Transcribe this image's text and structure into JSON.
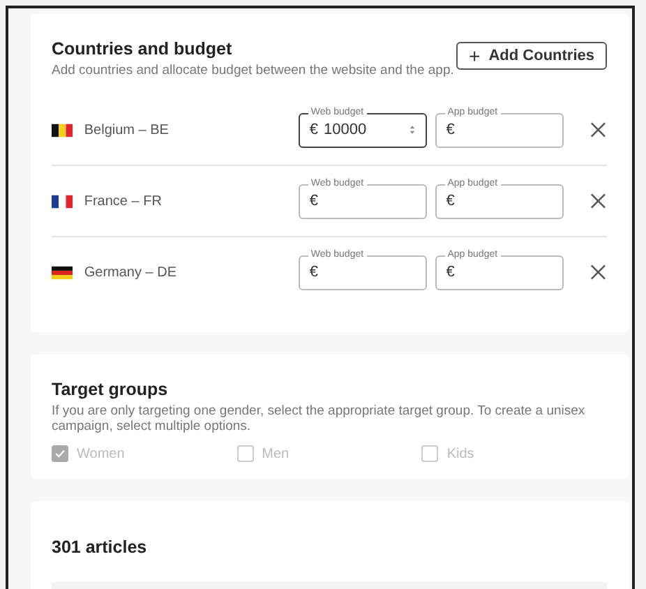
{
  "countries_card": {
    "title": "Countries and budget",
    "subtitle": "Add countries and allocate budget between the website and the app.",
    "add_button": {
      "icon": "+",
      "label": "Add Countries"
    },
    "rows": [
      {
        "name": "Belgium – BE",
        "flag": {
          "kind": "vertical",
          "stripes": [
            {
              "color": "#111111"
            },
            {
              "color": "#f5cf1b"
            },
            {
              "color": "#e0262f"
            }
          ]
        },
        "web_budget": {
          "label": "Web budget",
          "currency": "€",
          "value": "10000",
          "focused": true,
          "spinner": true
        },
        "app_budget": {
          "label": "App budget",
          "currency": "€",
          "focused": false,
          "spinner": false
        }
      },
      {
        "name": "France – FR",
        "flag": {
          "kind": "vertical",
          "stripes": [
            {
              "color": "#1f3b8f"
            },
            {
              "color": "#ffffff"
            },
            {
              "color": "#e0262f"
            }
          ]
        },
        "web_budget": {
          "label": "Web budget",
          "currency": "€",
          "focused": false,
          "spinner": false
        },
        "app_budget": {
          "label": "App budget",
          "currency": "€",
          "focused": false,
          "spinner": false
        }
      },
      {
        "name": "Germany – DE",
        "flag": {
          "kind": "horizontal",
          "stripes": [
            {
              "color": "#111111"
            },
            {
              "color": "#d8261c"
            },
            {
              "color": "#f5cf1b"
            }
          ]
        },
        "web_budget": {
          "label": "Web budget",
          "currency": "€",
          "focused": false,
          "spinner": false
        },
        "app_budget": {
          "label": "App budget",
          "currency": "€",
          "focused": false,
          "spinner": false
        }
      }
    ]
  },
  "target_card": {
    "title": "Target groups",
    "description": "If you are only targeting one gender, select the appropriate target group. To create a unisex campaign, select multiple options.",
    "options": [
      {
        "label": "Women",
        "checked": true,
        "disabled": true
      },
      {
        "label": "Men",
        "checked": false,
        "disabled": true
      },
      {
        "label": "Kids",
        "checked": false,
        "disabled": true
      }
    ]
  },
  "articles_card": {
    "title": "301 articles"
  }
}
